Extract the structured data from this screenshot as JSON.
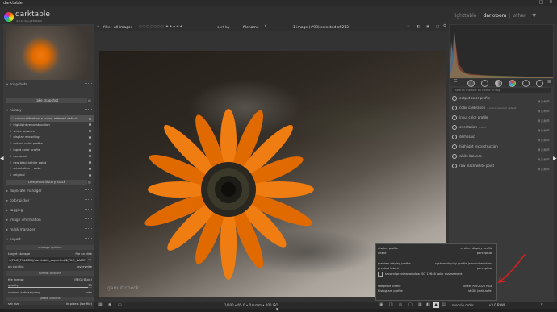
{
  "window": {
    "title": "darktable",
    "controls": [
      "—",
      "□",
      "✕"
    ]
  },
  "app": {
    "name": "darktable",
    "tagline": "4.4.0+dev-git500000"
  },
  "views": {
    "lighttable": "lighttable",
    "darkroom": "darkroom",
    "other": "other",
    "separator": "|"
  },
  "filter_bar": {
    "filter_label": "filter",
    "filter_value": "all images",
    "sort_label": "sort by",
    "sort_value": "filename",
    "count_text": "1 image (#93) selected of 213"
  },
  "left_panel": {
    "snapshots_label": "snapshots",
    "take_snapshot": "take snapshot",
    "history_label": "history",
    "history_items": [
      {
        "n": "10",
        "label": "color calibration • scene-referred default"
      },
      {
        "n": "9",
        "label": "highlight reconstruction"
      },
      {
        "n": "8",
        "label": "white balance"
      },
      {
        "n": "7",
        "label": "display encoding"
      },
      {
        "n": "6",
        "label": "output color profile"
      },
      {
        "n": "5",
        "label": "input color profile"
      },
      {
        "n": "4",
        "label": "demosaic"
      },
      {
        "n": "3",
        "label": "raw black/white point"
      },
      {
        "n": "2",
        "label": "orientation • auto"
      },
      {
        "n": "1",
        "label": "original"
      }
    ],
    "compress_history": "compress history stack",
    "sections": [
      "duplicate manager",
      "color picker",
      "tagging",
      "image information",
      "mask manager",
      "export"
    ],
    "storage_options": "storage options",
    "target_storage": {
      "label": "target storage",
      "value": "file on disk"
    },
    "path_value": "$(FILE_FOLDER)/darktable_exported/$(FILE_NAME)",
    "on_conflict": {
      "label": "on conflict",
      "value": "overwrite"
    },
    "format_options": "format options",
    "file_format": {
      "label": "file format",
      "value": "JPEG (8-bit)"
    },
    "quality": {
      "label": "quality",
      "value": "95"
    },
    "chroma": {
      "label": "chroma subsampling",
      "value": "auto"
    },
    "global_options": "global options",
    "set_size": {
      "label": "set size",
      "value": "in pixels (for file)"
    }
  },
  "right_panel": {
    "search_placeholder": "search module by name or tag",
    "modules": [
      {
        "name": "output color profile",
        "extra": ""
      },
      {
        "name": "color calibration",
        "extra": "• scene-referred default"
      },
      {
        "name": "input color profile",
        "extra": ""
      },
      {
        "name": "orientation",
        "extra": "• auto"
      },
      {
        "name": "demosaic",
        "extra": ""
      },
      {
        "name": "highlight reconstruction",
        "extra": ""
      },
      {
        "name": "white balance",
        "extra": ""
      },
      {
        "name": "raw black/white point",
        "extra": ""
      }
    ]
  },
  "popup": {
    "display_profile": {
      "label": "display profile",
      "value": "system display profile"
    },
    "intent": {
      "label": "intent",
      "value": "perceptual"
    },
    "preview_display_profile": {
      "label": "preview display profile",
      "value": "system display profile (second window)"
    },
    "preview_intent": {
      "label": "preview intent",
      "value": "perceptual"
    },
    "checkbox_label": "second preview window ISO 12646 color assessment",
    "softproof_profile": {
      "label": "softproof profile",
      "value": "linear Rec2020 RGB"
    },
    "histogram_profile": {
      "label": "histogram profile",
      "value": "sRGB (web-safe)"
    }
  },
  "bottom_bar": {
    "zoom_text": "1/200 • f/5.0 • 0.0 mm • 200 ISO",
    "module_order_label": "module order",
    "module_order_value": "v3.0 RAW"
  },
  "image": {
    "watermark": "gamut check"
  },
  "colors": {
    "accent": "#e06a00",
    "arrow": "#d02020"
  }
}
